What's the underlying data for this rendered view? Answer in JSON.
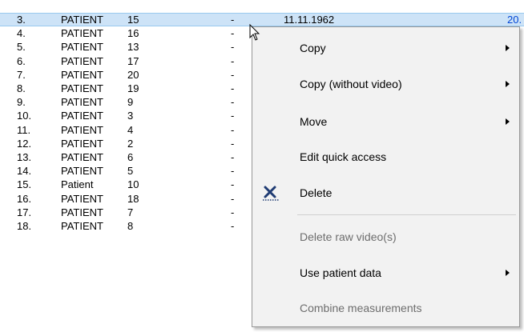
{
  "table": {
    "rows": [
      {
        "num": "3.",
        "name": "PATIENT",
        "id": "15",
        "dash": "-",
        "date": "11.11.1962",
        "extra": "20.",
        "selected": true
      },
      {
        "num": "4.",
        "name": "PATIENT",
        "id": "16",
        "dash": "-"
      },
      {
        "num": "5.",
        "name": "PATIENT",
        "id": "13",
        "dash": "-"
      },
      {
        "num": "6.",
        "name": "PATIENT",
        "id": "17",
        "dash": "-"
      },
      {
        "num": "7.",
        "name": "PATIENT",
        "id": "20",
        "dash": "-"
      },
      {
        "num": "8.",
        "name": "PATIENT",
        "id": "19",
        "dash": "-"
      },
      {
        "num": "9.",
        "name": "PATIENT",
        "id": "9",
        "dash": "-"
      },
      {
        "num": "10.",
        "name": "PATIENT",
        "id": "3",
        "dash": "-"
      },
      {
        "num": "11.",
        "name": "PATIENT",
        "id": "4",
        "dash": "-"
      },
      {
        "num": "12.",
        "name": "PATIENT",
        "id": "2",
        "dash": "-"
      },
      {
        "num": "13.",
        "name": "PATIENT",
        "id": "6",
        "dash": "-"
      },
      {
        "num": "14.",
        "name": "PATIENT",
        "id": "5",
        "dash": "-"
      },
      {
        "num": "15.",
        "name": "Patient",
        "id": "10",
        "dash": "-"
      },
      {
        "num": "16.",
        "name": "PATIENT",
        "id": "18",
        "dash": "-"
      },
      {
        "num": "17.",
        "name": "PATIENT",
        "id": "7",
        "dash": "-"
      },
      {
        "num": "18.",
        "name": "PATIENT",
        "id": "8",
        "dash": "-"
      }
    ]
  },
  "context_menu": {
    "items": [
      {
        "label": "Copy",
        "submenu": true,
        "disabled": false
      },
      {
        "label": "Copy (without video)",
        "submenu": true,
        "disabled": false
      },
      {
        "label": "Move",
        "submenu": true,
        "disabled": false
      },
      {
        "label": "Edit quick access",
        "submenu": false,
        "disabled": false
      },
      {
        "label": "Delete",
        "submenu": false,
        "disabled": false,
        "icon": "delete-x-icon"
      },
      {
        "label": "Delete raw video(s)",
        "submenu": false,
        "disabled": true
      },
      {
        "label": "Use patient data",
        "submenu": true,
        "disabled": false
      },
      {
        "label": "Combine measurements",
        "submenu": false,
        "disabled": true
      }
    ]
  },
  "colors": {
    "selection": "#cde3f7",
    "menu_bg": "#f2f2f2",
    "delete_icon": "#1f3b73"
  }
}
